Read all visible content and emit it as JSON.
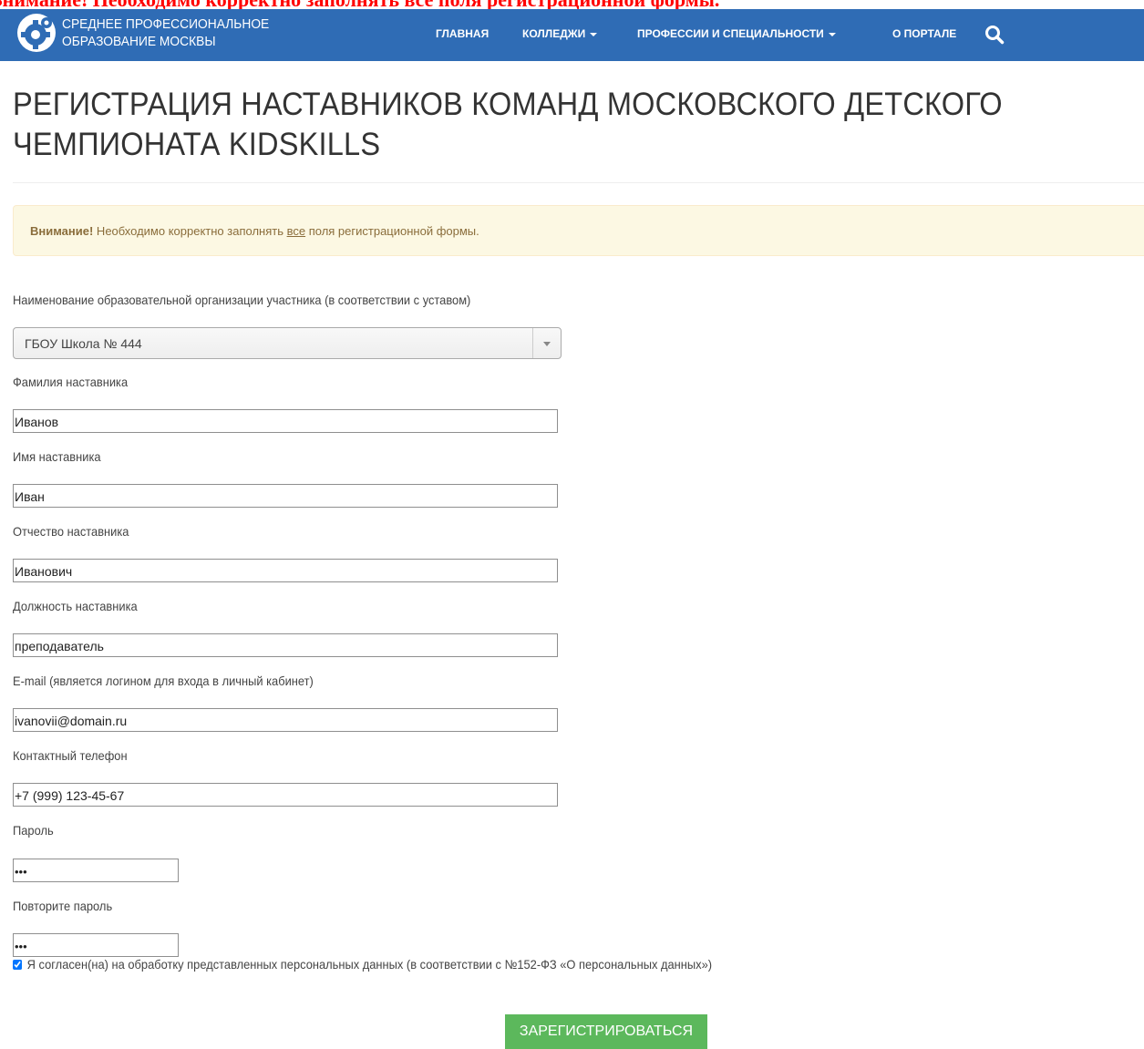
{
  "banner": {
    "text": "Внимание! Необходимо корректно заполнять все поля регистрационной формы."
  },
  "navbar": {
    "brand_line1": "СРЕДНЕЕ ПРОФЕССИОНАЛЬНОЕ",
    "brand_line2": "ОБРАЗОВАНИЕ МОСКВЫ",
    "items": [
      {
        "label": "ГЛАВНАЯ"
      },
      {
        "label": "КОЛЛЕДЖИ"
      },
      {
        "label": "ПРОФЕССИИ И СПЕЦИАЛЬНОСТИ"
      },
      {
        "label": "О ПОРТАЛЕ"
      }
    ],
    "search_icon": "search-icon",
    "color": "#2f6cb5"
  },
  "page": {
    "title": "РЕГИСТРАЦИЯ НАСТАВНИКОВ КОМАНД МОСКОВСКОГО ДЕТСКОГО ЧЕМПИОНАТА KIDSKILLS"
  },
  "alert": {
    "strong": "Внимание!",
    "text_before": " Необходимо корректно заполнять ",
    "underlined": "все",
    "text_after": " поля регистрационной формы."
  },
  "form": {
    "organization": {
      "label": "Наименование образовательной организации участника (в соответствии с уставом)",
      "value": "ГБОУ Школа № 444"
    },
    "last_name": {
      "label": "Фамилия наставника",
      "value": "Иванов"
    },
    "first_name": {
      "label": "Имя наставника",
      "value": "Иван"
    },
    "middle_name": {
      "label": "Отчество наставника",
      "value": "Иванович"
    },
    "position": {
      "label": "Должность наставника",
      "value": "преподаватель"
    },
    "email": {
      "label": "E-mail (является логином для входа в личный кабинет)",
      "value": "ivanovii@domain.ru"
    },
    "phone": {
      "label": "Контактный телефон",
      "value": "+7 (999) 123-45-67"
    },
    "password": {
      "label": "Пароль",
      "value": "•••"
    },
    "password_repeat": {
      "label": "Повторите пароль",
      "value": "•••"
    },
    "consent": {
      "label": "Я согласен(на) на обработку представленных персональных данных (в соответствии с №152-ФЗ «О персональных данных»)",
      "checked": true
    },
    "submit_label": "ЗАРЕГИСТРИРОВАТЬСЯ",
    "submit_color": "#5cb85c"
  }
}
